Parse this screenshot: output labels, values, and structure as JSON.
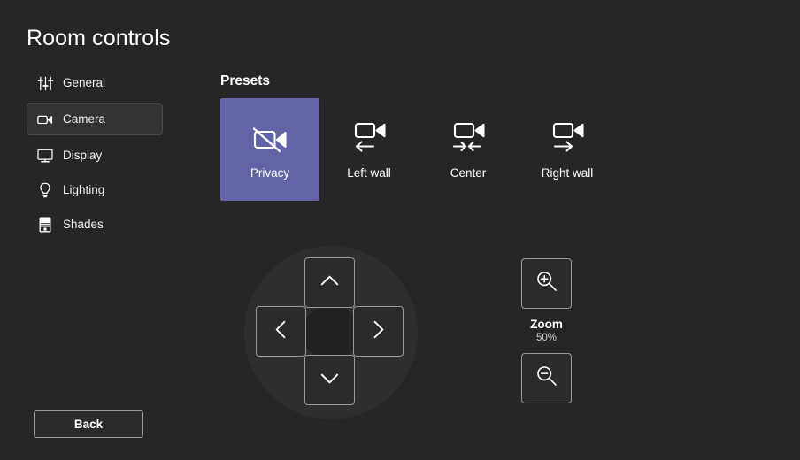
{
  "page": {
    "title": "Room controls",
    "background_color": "#262626",
    "accent_color": "#6264a7"
  },
  "sidebar": {
    "items": [
      {
        "label": "General",
        "icon": "sliders-icon",
        "selected": false
      },
      {
        "label": "Camera",
        "icon": "camera-icon",
        "selected": true
      },
      {
        "label": "Display",
        "icon": "monitor-icon",
        "selected": false
      },
      {
        "label": "Lighting",
        "icon": "lightbulb-icon",
        "selected": false
      },
      {
        "label": "Shades",
        "icon": "shades-icon",
        "selected": false
      }
    ]
  },
  "back_button": {
    "label": "Back"
  },
  "presets": {
    "heading": "Presets",
    "items": [
      {
        "label": "Privacy",
        "icon": "camera-off-icon",
        "selected": true
      },
      {
        "label": "Left wall",
        "icon": "camera-arrow-left-icon",
        "selected": false
      },
      {
        "label": "Center",
        "icon": "camera-arrows-center-icon",
        "selected": false
      },
      {
        "label": "Right wall",
        "icon": "camera-arrow-right-icon",
        "selected": false
      }
    ]
  },
  "pan_tilt": {
    "up": {
      "icon": "chevron-up-icon"
    },
    "left": {
      "icon": "chevron-left-icon"
    },
    "right": {
      "icon": "chevron-right-icon"
    },
    "down": {
      "icon": "chevron-down-icon"
    }
  },
  "zoom": {
    "title": "Zoom",
    "value": "50%",
    "zoom_in_icon": "magnifier-plus-icon",
    "zoom_out_icon": "magnifier-minus-icon"
  }
}
